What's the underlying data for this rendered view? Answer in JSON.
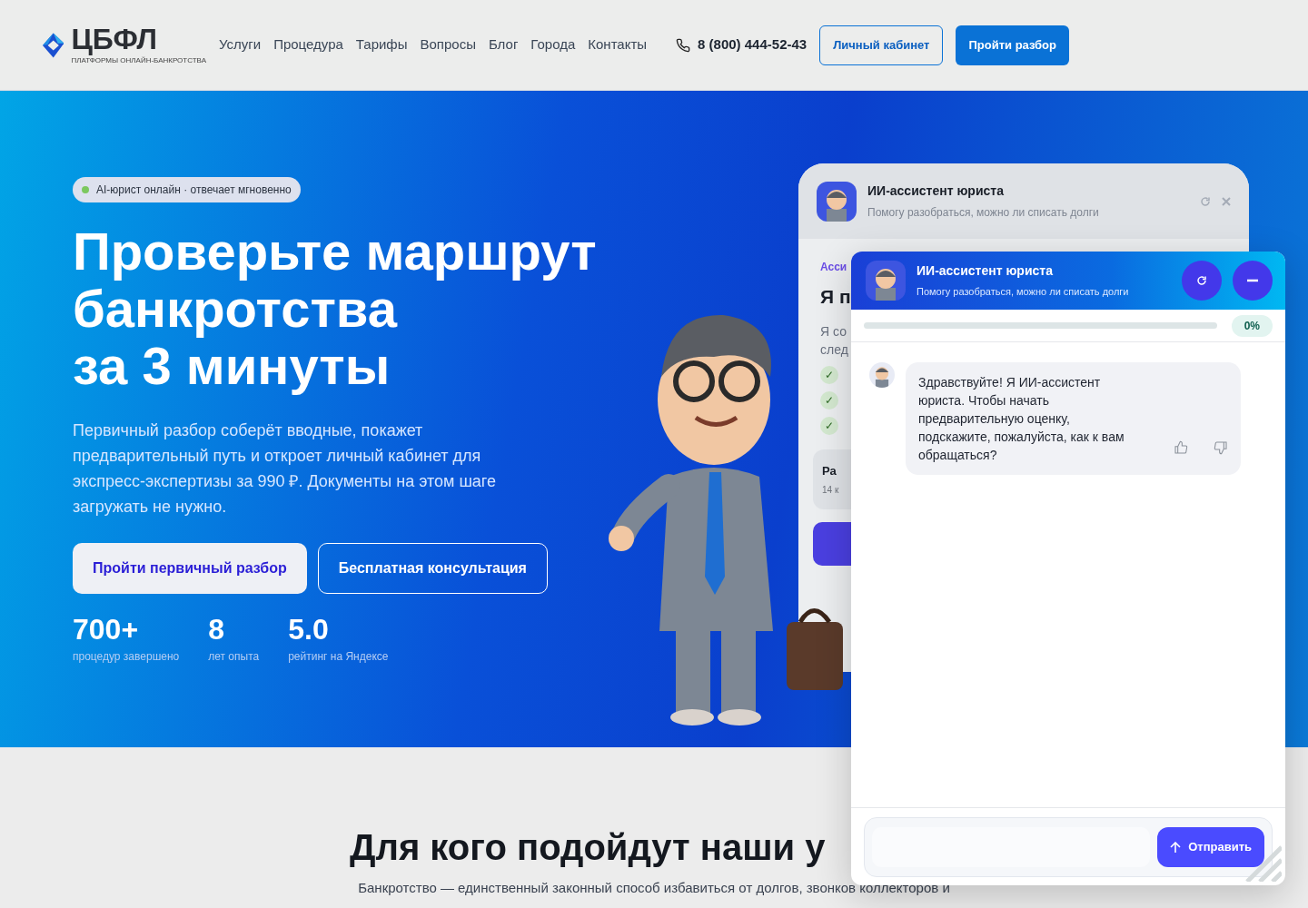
{
  "header": {
    "logo": {
      "name": "ЦБФЛ",
      "tagline": "ПЛАТФОРМЫ ОНЛАЙН-БАНКРОТСТВА"
    },
    "nav": [
      "Услуги",
      "Процедура",
      "Тарифы",
      "Вопросы",
      "Блог",
      "Города",
      "Контакты"
    ],
    "phone": "8 (800) 444-52-43",
    "buttons": [
      {
        "label": "Личный кабинет",
        "kind": "outline"
      },
      {
        "label": "Пройти разбор",
        "kind": "filled"
      }
    ]
  },
  "hero": {
    "badge": {
      "text": "AI-юрист онлайн · отвечает мгновенно",
      "online": true
    },
    "title_lines": [
      "Проверьте маршрут",
      "банкротства",
      "за 3 минуты"
    ],
    "lead": "Первичный разбор соберёт вводные, покажет предварительный путь и откроет личный кабинет для экспресс-экспертизы за 990 ₽. Документы на этом шаге загружать не нужно.",
    "buttons": [
      {
        "label": "Пройти первичный разбор",
        "kind": "filled"
      },
      {
        "label": "Бесплатная консультация",
        "kind": "outline"
      }
    ],
    "stats": [
      {
        "value": "700+",
        "label": "процедур завершено"
      },
      {
        "value": "8",
        "label": "лет опыта"
      },
      {
        "value": "5.0",
        "label": "рейтинг на Яндексе"
      }
    ]
  },
  "background_card": {
    "title": "ИИ-ассистент юриста",
    "subtitle": "Помогу разобраться, можно ли списать долги",
    "eyebrow": "Асси",
    "heading": "Я п",
    "text_lines": [
      "Я со",
      "след"
    ],
    "checks": [
      "✓",
      "✓",
      "✓"
    ],
    "block_title": "Ра",
    "block_sub": "14 к"
  },
  "chat": {
    "title": "ИИ-ассистент юриста",
    "subtitle": "Помогу разобраться, можно ли списать долги",
    "progress": {
      "level": 0,
      "reading": "0%"
    },
    "messages": [
      {
        "text": "Здравствуйте! Я ИИ-ассистент юриста. Чтобы начать предварительную оценку, подскажите, пожалуйста, как к вам обращаться?"
      }
    ],
    "send_button": "Отправить"
  },
  "section": {
    "title": "Для кого подойдут наши у",
    "subtitle": "Банкротство — единственный законный способ избавиться от долгов, звонков коллекторов и"
  }
}
